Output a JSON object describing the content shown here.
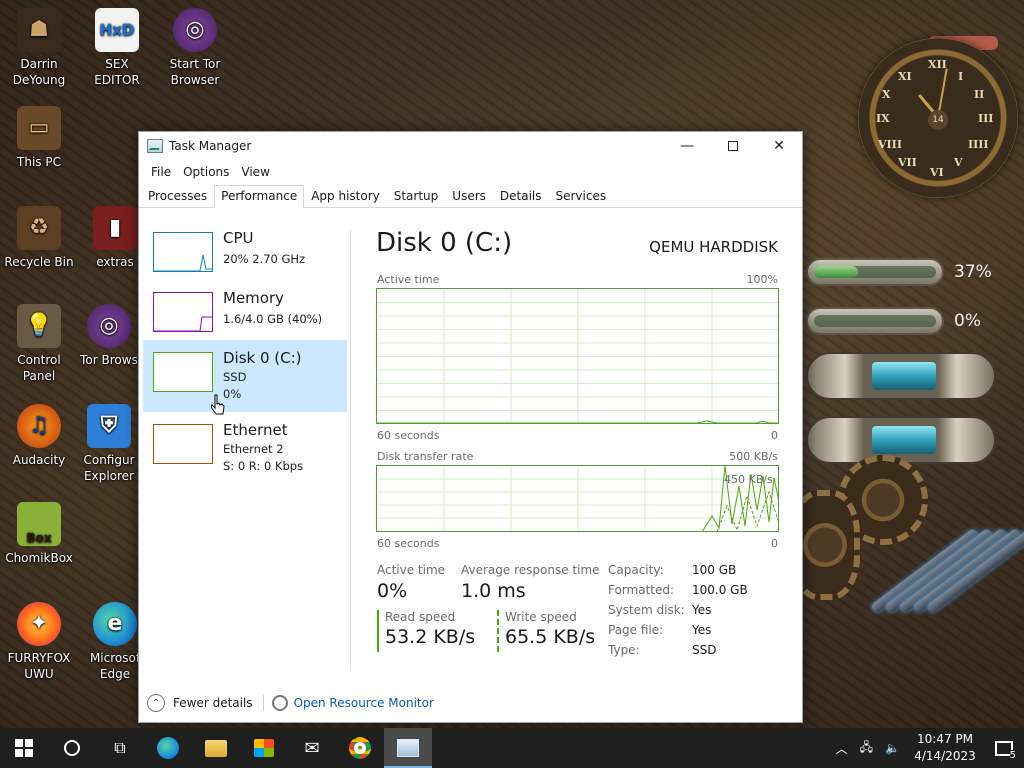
{
  "desktop": {
    "icons": [
      {
        "label": "Darrin\nDeYoung"
      },
      {
        "label": "SEX\nEDITOR"
      },
      {
        "label": "Start Tor\nBrowser"
      },
      {
        "label": "This PC"
      },
      {
        "label": "Recycle Bin"
      },
      {
        "label": "extras"
      },
      {
        "label": "Control Panel"
      },
      {
        "label": "Tor Brows"
      },
      {
        "label": "Audacity"
      },
      {
        "label": "Configur\nExplorer"
      },
      {
        "label": "ChomikBox"
      },
      {
        "label": "FURRYFOX\nUWU"
      },
      {
        "label": "Microsof\nEdge"
      }
    ],
    "hex_icon_text": "HxD",
    "chomik_badge": "Box",
    "widget": {
      "gauge1_pct": "37%",
      "gauge1_level": 0.37,
      "gauge2_pct": "0%",
      "gauge2_level": 0.0,
      "clock_date": "14",
      "clock_numerals": [
        "XII",
        "I",
        "II",
        "III",
        "IIII",
        "V",
        "VI",
        "VII",
        "VIII",
        "IX",
        "X",
        "XI"
      ]
    }
  },
  "window": {
    "title": "Task Manager",
    "menu": [
      "File",
      "Options",
      "View"
    ],
    "tabs": [
      "Processes",
      "Performance",
      "App history",
      "Startup",
      "Users",
      "Details",
      "Services"
    ],
    "active_tab": "Performance",
    "sidebar": [
      {
        "name": "CPU",
        "line1": "20%  2.70 GHz",
        "line2": "",
        "color": "#117dbb"
      },
      {
        "name": "Memory",
        "line1": "1.6/4.0 GB (40%)",
        "line2": "",
        "color": "#8b12ae"
      },
      {
        "name": "Disk 0 (C:)",
        "line1": "SSD",
        "line2": "0%",
        "color": "#4da60c"
      },
      {
        "name": "Ethernet",
        "line1": "Ethernet 2",
        "line2": "S: 0  R: 0 Kbps",
        "color": "#a74f01"
      }
    ],
    "selected_sidebar": "Disk 0 (C:)",
    "main": {
      "title": "Disk 0 (C:)",
      "model": "QEMU HARDDISK",
      "graph1": {
        "label": "Active time",
        "max": "100%",
        "footer_left": "60 seconds",
        "footer_right": "0"
      },
      "graph2": {
        "label": "Disk transfer rate",
        "max": "500 KB/s",
        "inner_label": "450 KB/s",
        "footer_left": "60 seconds",
        "footer_right": "0"
      },
      "stats": {
        "active_time_label": "Active time",
        "active_time_value": "0%",
        "avg_resp_label": "Average response time",
        "avg_resp_value": "1.0 ms",
        "read_label": "Read speed",
        "read_value": "53.2 KB/s",
        "write_label": "Write speed",
        "write_value": "65.5 KB/s"
      },
      "properties": [
        {
          "key": "Capacity:",
          "value": "100 GB"
        },
        {
          "key": "Formatted:",
          "value": "100.0 GB"
        },
        {
          "key": "System disk:",
          "value": "Yes"
        },
        {
          "key": "Page file:",
          "value": "Yes"
        },
        {
          "key": "Type:",
          "value": "SSD"
        }
      ]
    },
    "footer": {
      "fewer_details": "Fewer details",
      "open_monitor": "Open Resource Monitor"
    }
  },
  "taskbar": {
    "time": "10:47 PM",
    "date": "4/14/2023",
    "notification_count": "5"
  },
  "colors": {
    "disk_green": "#4da60c",
    "selected_bg": "#cce8ff",
    "link": "#0b5cad"
  }
}
